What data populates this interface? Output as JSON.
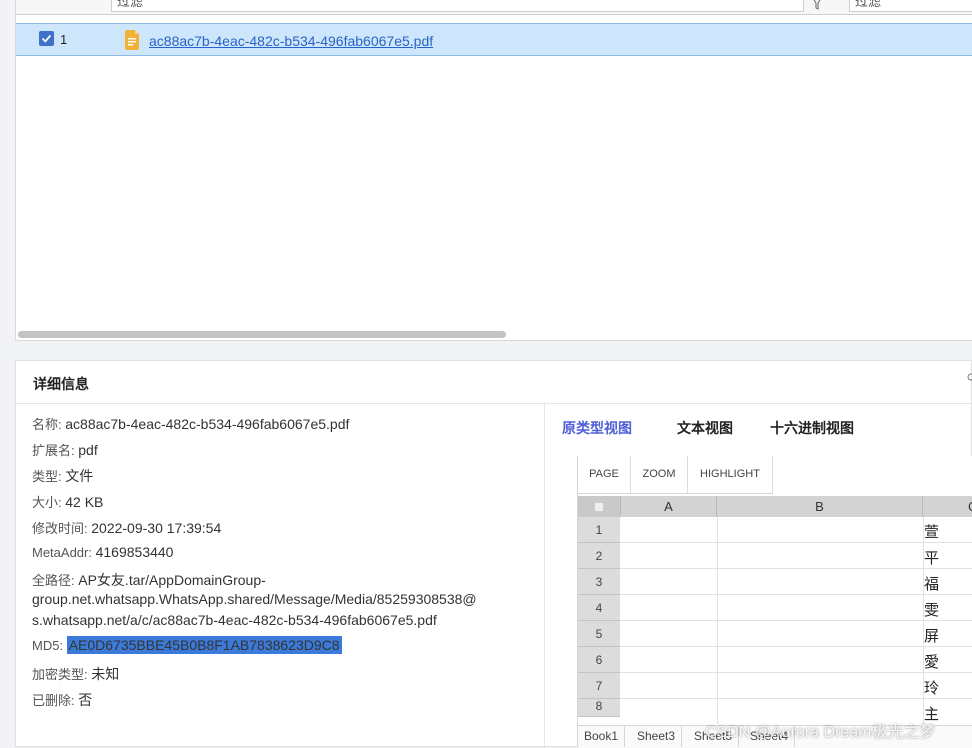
{
  "file_list": {
    "filter_placeholder_1": "过滤",
    "filter_placeholder_2": "过滤",
    "row": {
      "index": "1",
      "checked": true,
      "file_name": "ac88ac7b-4eac-482c-b534-496fab6067e5.pdf"
    }
  },
  "details": {
    "title": "详细信息",
    "fields": [
      {
        "label": "名称:",
        "value": "ac88ac7b-4eac-482c-b534-496fab6067e5.pdf"
      },
      {
        "label": "扩展名:",
        "value": "pdf"
      },
      {
        "label": "类型:",
        "value": "文件"
      },
      {
        "label": "大小:",
        "value": "42 KB"
      },
      {
        "label": "修改时间:",
        "value": "2022-09-30 17:39:54"
      },
      {
        "label": "MetaAddr:",
        "value": "4169853440"
      }
    ],
    "path_label": "全路径:",
    "path_lines": [
      "AP女友.tar/AppDomainGroup-",
      "group.net.whatsapp.WhatsApp.shared/Message/Media/85259308538@",
      "s.whatsapp.net/a/c/ac88ac7b-4eac-482c-b534-496fab6067e5.pdf"
    ],
    "md5_label": "MD5:",
    "md5_value": "AE0D6735BBE45B0B8F1AB7838623D9C8",
    "encrypt_label": "加密类型:",
    "encrypt_value": "未知",
    "deleted_label": "已删除:",
    "deleted_value": "否"
  },
  "viewer": {
    "tabs": [
      "原类型视图",
      "文本视图",
      "十六进制视图"
    ],
    "active_tab": 0,
    "toolbar": [
      "PAGE",
      "ZOOM",
      "HIGHLIGHT"
    ],
    "columns": [
      "A",
      "B",
      "C"
    ],
    "rows": [
      "1",
      "2",
      "3",
      "4",
      "5",
      "6",
      "7",
      "8"
    ],
    "cells_col_c": [
      "萱",
      "平",
      "福",
      "雯",
      "屏",
      "愛",
      "玲",
      "主"
    ],
    "sheet_tabs": [
      "Book1",
      "Sheet3",
      "Sheet5",
      "Sheet4"
    ]
  },
  "watermark": "CSDN @Aurora Dream极光之梦",
  "colors": {
    "accent": "#4f5fd6",
    "selection": "#cde6fb",
    "md5_highlight": "#3b7ad9",
    "link": "#2a63c7"
  }
}
